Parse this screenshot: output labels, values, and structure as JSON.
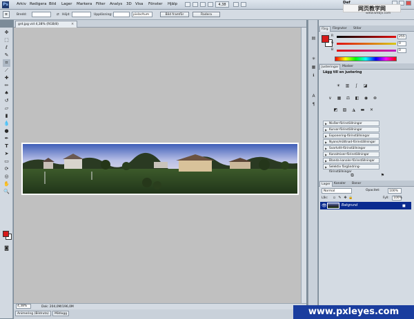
{
  "app": {
    "logo": "Ps",
    "menus": [
      "Arkiv",
      "Redigera",
      "Bild",
      "Lager",
      "Markera",
      "Filter",
      "Analys",
      "3D",
      "Visa",
      "Fönster",
      "Hjälp"
    ],
    "zoom": "4,38",
    "workspace": "Def"
  },
  "options": {
    "width_label": "Bredd:",
    "width_value": "",
    "height_label": "Höjd:",
    "height_value": "",
    "resolution_label": "Upplösning:",
    "resolution_value": "",
    "resolution_unit": "pixlar/tum",
    "front_image_button": "Bild framför",
    "clear_button": "Radera"
  },
  "document": {
    "tab_title": "grd.jpg vid 4,38% (RGB/8)",
    "close": "×",
    "status_zoom": "4,38%",
    "status_doc": "Dok: 204,0M/196,0M",
    "bottom_tabs": [
      "Animering (Bildruta)",
      "Mätlogg"
    ]
  },
  "color_panel": {
    "tabs": [
      "Färg",
      "Färgrutor",
      "Stilar"
    ],
    "channels": [
      {
        "label": "R",
        "value": "255",
        "color": "#e01010"
      },
      {
        "label": "G",
        "value": "0",
        "color": "#d8c818"
      },
      {
        "label": "B",
        "value": "0",
        "color": "#c020c0"
      }
    ]
  },
  "adjust_panel": {
    "tabs": [
      "Justeringar",
      "Masker"
    ],
    "title": "Lägg till en justering",
    "presets": [
      "Nivåer-förinställningar",
      "Kurvor-förinställningar",
      "Exponering-förinställningar",
      "Nyans/mättnad-förinställningar",
      "Svartvitt-förinställningar",
      "Kanalmixer-förinställningar",
      "Blanda kanaler-förinställningar",
      "Selektiv färgändring-förinställningar"
    ]
  },
  "layers_panel": {
    "tabs": [
      "Lager",
      "Kanaler",
      "Banor"
    ],
    "blend_mode": "Normal",
    "opacity_label": "Opacitet:",
    "opacity": "100%",
    "lock_label": "Lås:",
    "fill_label": "Fyll:",
    "fill": "100%",
    "layer_name": "Bakgrund"
  },
  "watermarks": {
    "top_main": "网页教学网",
    "top_sub": "www.webjx.com",
    "bottom": "www.pxleyes.com"
  }
}
